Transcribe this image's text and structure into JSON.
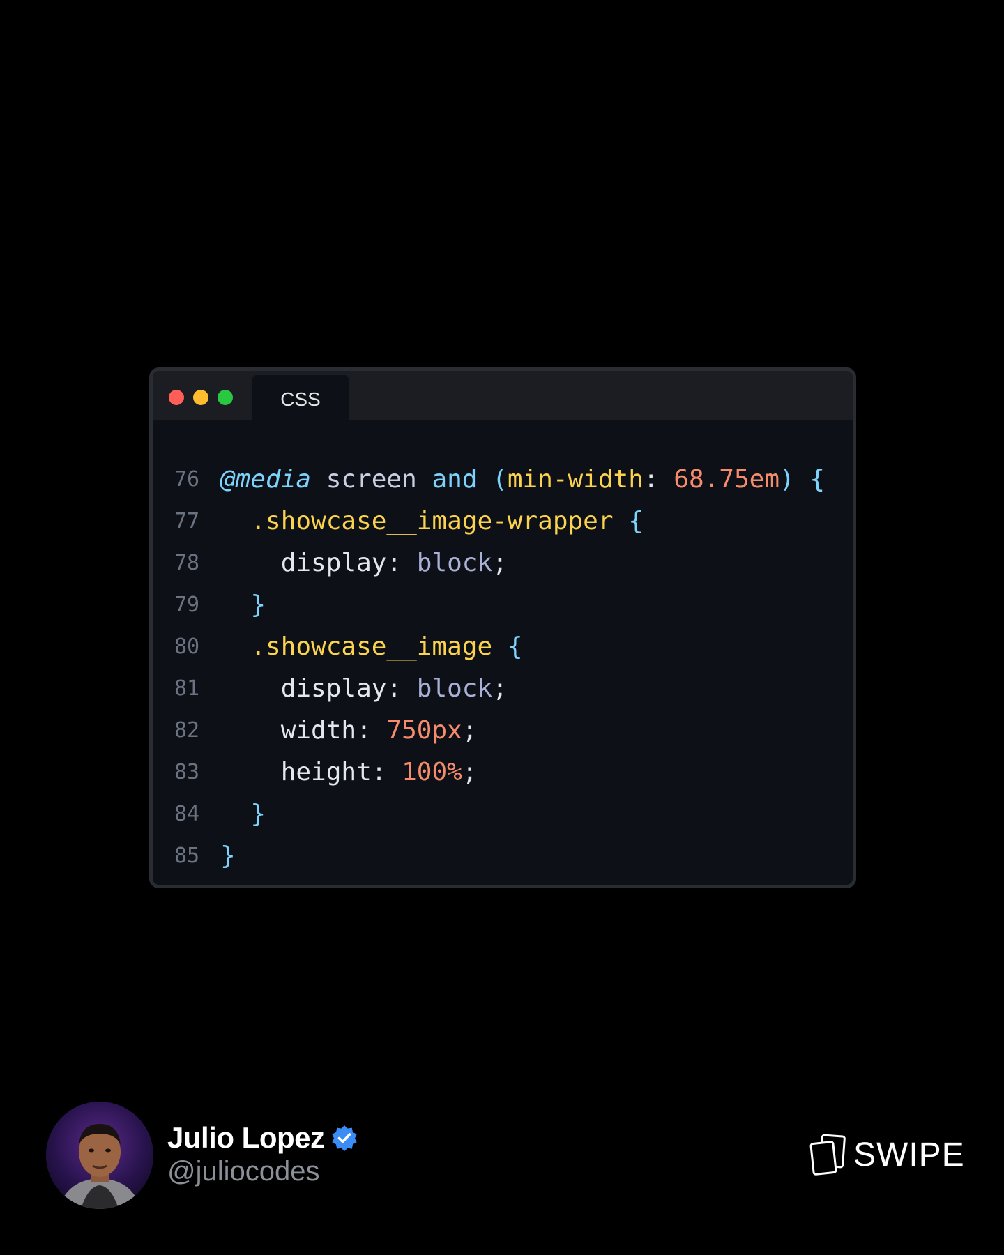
{
  "editor": {
    "tab_label": "CSS",
    "lines": [
      {
        "num": "76",
        "tokens": [
          [
            "@media",
            "t-at"
          ],
          [
            " screen ",
            "t-plain"
          ],
          [
            "and",
            "t-kw"
          ],
          [
            " ",
            "t-plain"
          ],
          [
            "(",
            "t-paren"
          ],
          [
            "min-width",
            "t-feature"
          ],
          [
            ": ",
            "t-punct"
          ],
          [
            "68.75em",
            "t-num"
          ],
          [
            ")",
            "t-paren"
          ],
          [
            " ",
            "t-plain"
          ],
          [
            "{",
            "t-brace"
          ]
        ]
      },
      {
        "num": "77",
        "tokens": [
          [
            "  .showcase__image-wrapper",
            "t-sel"
          ],
          [
            " ",
            "t-plain"
          ],
          [
            "{",
            "t-brace"
          ]
        ]
      },
      {
        "num": "78",
        "tokens": [
          [
            "    display",
            "t-prop"
          ],
          [
            ": ",
            "t-punct"
          ],
          [
            "block",
            "t-val"
          ],
          [
            ";",
            "t-punct"
          ]
        ]
      },
      {
        "num": "79",
        "tokens": [
          [
            "  ",
            "t-plain"
          ],
          [
            "}",
            "t-brace"
          ]
        ]
      },
      {
        "num": "80",
        "tokens": [
          [
            "  .showcase__image",
            "t-sel"
          ],
          [
            " ",
            "t-plain"
          ],
          [
            "{",
            "t-brace"
          ]
        ]
      },
      {
        "num": "81",
        "tokens": [
          [
            "    display",
            "t-prop"
          ],
          [
            ": ",
            "t-punct"
          ],
          [
            "block",
            "t-val"
          ],
          [
            ";",
            "t-punct"
          ]
        ]
      },
      {
        "num": "82",
        "tokens": [
          [
            "    width",
            "t-prop"
          ],
          [
            ": ",
            "t-punct"
          ],
          [
            "750px",
            "t-num"
          ],
          [
            ";",
            "t-punct"
          ]
        ]
      },
      {
        "num": "83",
        "tokens": [
          [
            "    height",
            "t-prop"
          ],
          [
            ": ",
            "t-punct"
          ],
          [
            "100%",
            "t-num"
          ],
          [
            ";",
            "t-punct"
          ]
        ]
      },
      {
        "num": "84",
        "tokens": [
          [
            "  ",
            "t-plain"
          ],
          [
            "}",
            "t-brace"
          ]
        ]
      },
      {
        "num": "85",
        "tokens": [
          [
            "}",
            "t-brace"
          ]
        ]
      }
    ]
  },
  "author": {
    "name": "Julio Lopez",
    "handle": "@juliocodes",
    "verified": true
  },
  "swipe": {
    "label": "SWIPE",
    "icon": "swipe-cards-icon"
  },
  "colors": {
    "background": "#000000",
    "editor_bg": "#0d1017",
    "selector": "#fcd34d",
    "number": "#f78c6c",
    "keyword": "#7dd3fc",
    "verified_badge": "#3b8cf5"
  }
}
